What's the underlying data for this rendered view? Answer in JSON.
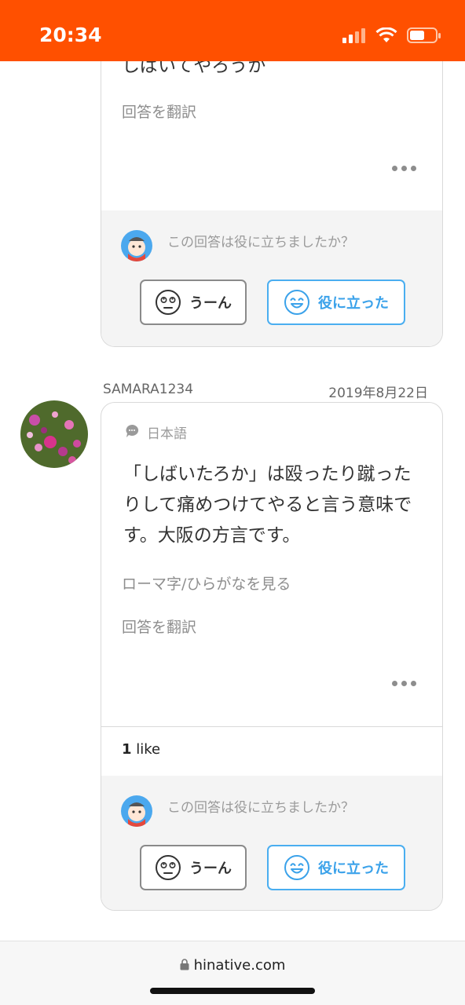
{
  "status": {
    "time": "20:34"
  },
  "answer1": {
    "text_tail": "しばいてやろうか",
    "translate": "回答を翻訳",
    "feedback": {
      "question": "この回答は役に立ちましたか？",
      "btn_un": "うーん",
      "btn_yaku": "役に立った"
    }
  },
  "answer2": {
    "username": "SAMARA1234",
    "date": "2019年8月22日",
    "language": "日本語",
    "text": "「しばいたろか」は殴ったり蹴ったりして痛めつけてやると言う意味です。大阪の方言です。",
    "romaji_link": "ローマ字/ひらがなを見る",
    "translate": "回答を翻訳",
    "likes_count": "1",
    "likes_label": "like",
    "feedback": {
      "question": "この回答は役に立ちましたか？",
      "btn_un": "うーん",
      "btn_yaku": "役に立った"
    }
  },
  "browser": {
    "url": "hinative.com"
  },
  "colors": {
    "status_bar": "#ff5000",
    "helpful_blue": "#4aaef0"
  },
  "icons": [
    "signal-icon",
    "wifi-icon",
    "battery-icon",
    "speech-bubble-icon",
    "ellipsis-icon",
    "confused-face-icon",
    "smile-face-icon",
    "lock-icon"
  ]
}
